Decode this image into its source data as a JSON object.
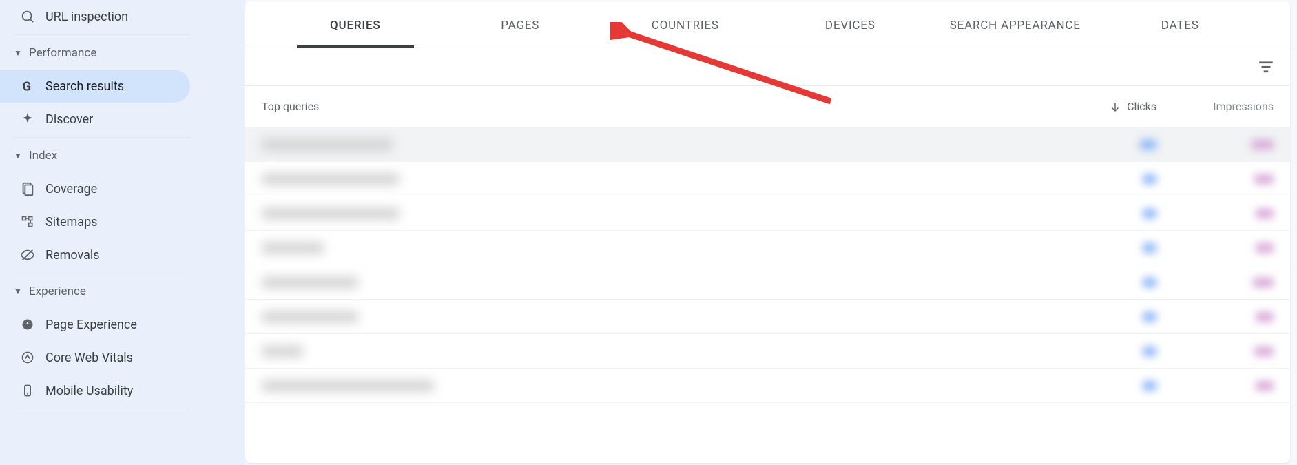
{
  "sidebar": {
    "url_inspection": "URL inspection",
    "sections": {
      "performance": {
        "header": "Performance",
        "items": {
          "search_results": "Search results",
          "discover": "Discover"
        }
      },
      "index": {
        "header": "Index",
        "items": {
          "coverage": "Coverage",
          "sitemaps": "Sitemaps",
          "removals": "Removals"
        }
      },
      "experience": {
        "header": "Experience",
        "items": {
          "page_experience": "Page Experience",
          "core_web_vitals": "Core Web Vitals",
          "mobile_usability": "Mobile Usability"
        }
      }
    }
  },
  "tabs": {
    "queries": "QUERIES",
    "pages": "PAGES",
    "countries": "COUNTRIES",
    "devices": "DEVICES",
    "search_appearance": "SEARCH APPEARANCE",
    "dates": "DATES"
  },
  "table": {
    "top_queries": "Top queries",
    "clicks": "Clicks",
    "impressions": "Impressions",
    "rows": [
      {
        "qw": 190,
        "cw": 24,
        "iw": 32
      },
      {
        "qw": 200,
        "cw": 20,
        "iw": 28
      },
      {
        "qw": 200,
        "cw": 20,
        "iw": 26
      },
      {
        "qw": 90,
        "cw": 20,
        "iw": 26
      },
      {
        "qw": 140,
        "cw": 20,
        "iw": 30
      },
      {
        "qw": 140,
        "cw": 20,
        "iw": 26
      },
      {
        "qw": 60,
        "cw": 20,
        "iw": 28
      },
      {
        "qw": 250,
        "cw": 20,
        "iw": 26
      }
    ]
  }
}
